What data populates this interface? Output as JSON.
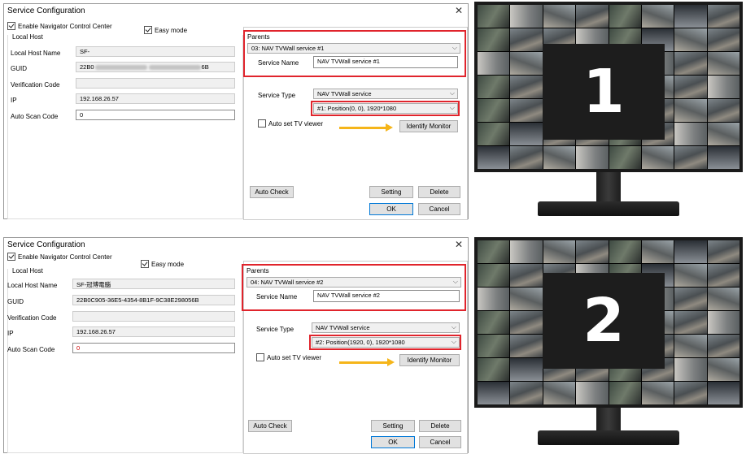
{
  "dialogs": [
    {
      "title": "Service Configuration",
      "close": "✕",
      "enable_ncc": "Enable Navigator Control Center",
      "easy_mode": "Easy mode",
      "local_host": "Local Host",
      "local_host_name_label": "Local Host Name",
      "local_host_name": "SF-",
      "guid_label": "GUID",
      "guid_prefix": "22B0",
      "guid_suffix": "6B",
      "verification_label": "Verification Code",
      "verification": "",
      "ip_label": "IP",
      "ip": "192.168.26.57",
      "auto_scan_label": "Auto Scan Code",
      "auto_scan": "0",
      "parents_label": "Parents",
      "parents_value": "03: NAV TVWall service #1",
      "service_name_label": "Service Name",
      "service_name": "NAV TVWall service #1",
      "service_type_label": "Service Type",
      "service_type": "NAV TVWall service",
      "position": "#1: Position(0, 0), 1920*1080",
      "auto_set_tv": "Auto set TV viewer",
      "identify": "Identify Monitor",
      "auto_check": "Auto Check",
      "setting": "Setting",
      "delete": "Delete",
      "ok": "OK",
      "cancel": "Cancel"
    },
    {
      "title": "Service Configuration",
      "close": "✕",
      "enable_ncc": "Enable Navigator Control Center",
      "easy_mode": "Easy mode",
      "local_host": "Local Host",
      "local_host_name_label": "Local Host Name",
      "local_host_name": "SF-冠博電腦",
      "guid_label": "GUID",
      "guid": "22B0C905-36E5-4354-8B1F-9C38E298056B",
      "verification_label": "Verification Code",
      "verification": "",
      "ip_label": "IP",
      "ip": "192.168.26.57",
      "auto_scan_label": "Auto Scan Code",
      "auto_scan": "0",
      "parents_label": "Parents",
      "parents_value": "04: NAV TVWall service #2",
      "service_name_label": "Service Name",
      "service_name": "NAV TVWall service #2",
      "service_type_label": "Service Type",
      "service_type": "NAV TVWall service",
      "position": "#2: Position(1920, 0), 1920*1080",
      "auto_set_tv": "Auto set TV viewer",
      "identify": "Identify Monitor",
      "auto_check": "Auto Check",
      "setting": "Setting",
      "delete": "Delete",
      "ok": "OK",
      "cancel": "Cancel"
    }
  ],
  "monitors": [
    {
      "number": "1"
    },
    {
      "number": "2"
    }
  ],
  "colors": {
    "highlight": "#e0242c",
    "arrow": "#f5b51a",
    "ok_border": "#0078d7"
  }
}
